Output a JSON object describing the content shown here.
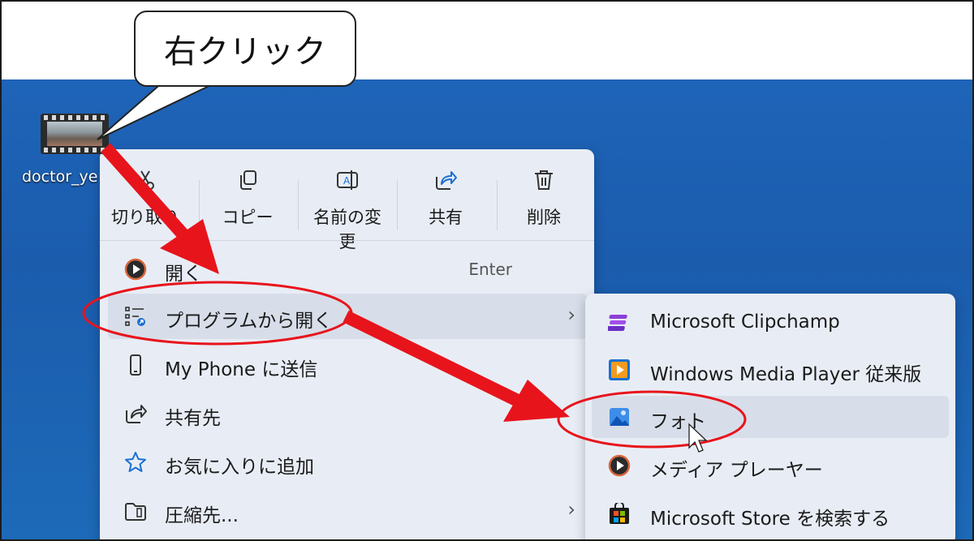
{
  "callout": {
    "text": "右クリック"
  },
  "desktop_icon": {
    "label": "doctor_ye",
    "icon": "video-file-icon"
  },
  "context_menu": {
    "toolbar": [
      {
        "label": "切り取り",
        "icon": "cut-icon"
      },
      {
        "label": "コピー",
        "icon": "copy-icon"
      },
      {
        "label": "名前の変更",
        "icon": "rename-icon"
      },
      {
        "label": "共有",
        "icon": "share-icon"
      },
      {
        "label": "削除",
        "icon": "delete-icon"
      }
    ],
    "items": [
      {
        "label": "開く",
        "shortcut": "Enter",
        "icon": "media-player-icon"
      },
      {
        "label": "プログラムから開く",
        "chevron": "›",
        "icon": "open-with-icon"
      },
      {
        "label": "My Phone に送信",
        "icon": "phone-icon"
      },
      {
        "label": "共有先",
        "icon": "share-icon"
      },
      {
        "label": "お気に入りに追加",
        "icon": "star-icon"
      },
      {
        "label": "圧縮先...",
        "chevron": "›",
        "icon": "zip-icon"
      }
    ]
  },
  "submenu": {
    "items": [
      {
        "label": "Microsoft Clipchamp",
        "icon": "clipchamp-icon"
      },
      {
        "label": "Windows Media Player 従来版",
        "icon": "windows-media-player-icon"
      },
      {
        "label": "フォト",
        "icon": "photos-icon"
      },
      {
        "label": "メディア プレーヤー",
        "icon": "media-player-icon"
      },
      {
        "label": "Microsoft Store を検索する",
        "icon": "store-icon"
      }
    ]
  },
  "colors": {
    "desktop": "#1e64b8",
    "menu": "#e8edf5",
    "annotation": "#e8141c"
  }
}
